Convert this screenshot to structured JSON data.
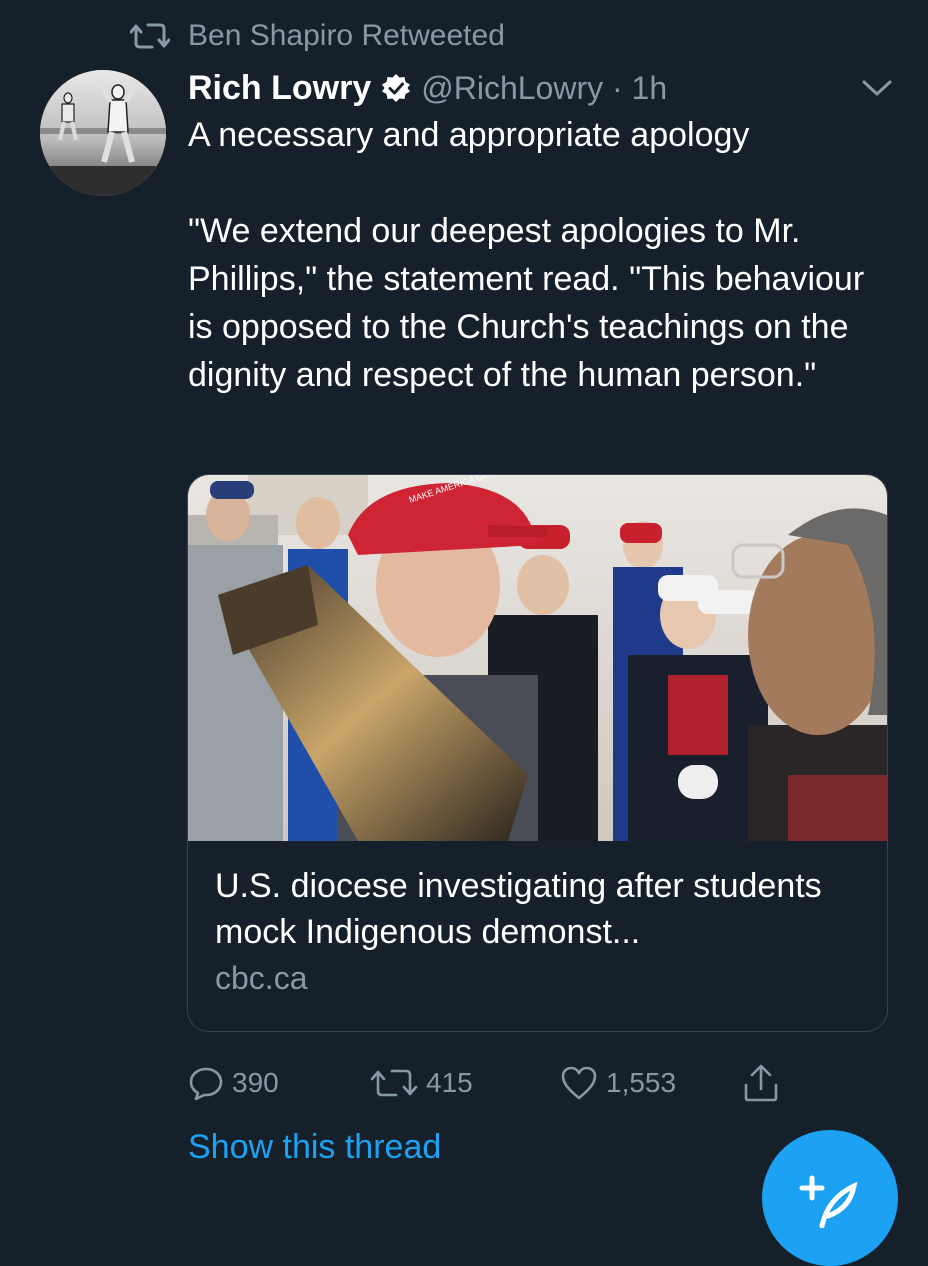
{
  "retweet": {
    "text": "Ben Shapiro Retweeted",
    "icon": "retweet-icon"
  },
  "tweet": {
    "display_name": "Rich Lowry",
    "verified_icon": "verified-badge-icon",
    "handle_time": "@RichLowry · 1h",
    "text": "A necessary and appropriate apology\n\n\"We extend our deepest apologies to Mr. Phillips,\" the statement read. \"This behaviour is opposed to the Church's teachings on the dignity and respect of the human person.\""
  },
  "card": {
    "title": "U.S. diocese investigating after students mock Indigenous demonst...",
    "domain": "cbc.ca",
    "image_caption_text": "MAKE AMERICA GREAT AGAIN"
  },
  "actions": {
    "reply_count": "390",
    "retweet_count": "415",
    "like_count": "1,553",
    "icons": [
      "reply-icon",
      "retweet-icon",
      "like-icon",
      "share-icon"
    ]
  },
  "show_thread": "Show this thread",
  "colors": {
    "background": "#15202b",
    "secondary_text": "#8899a6",
    "accent": "#1da1f2",
    "border": "#38444d"
  }
}
